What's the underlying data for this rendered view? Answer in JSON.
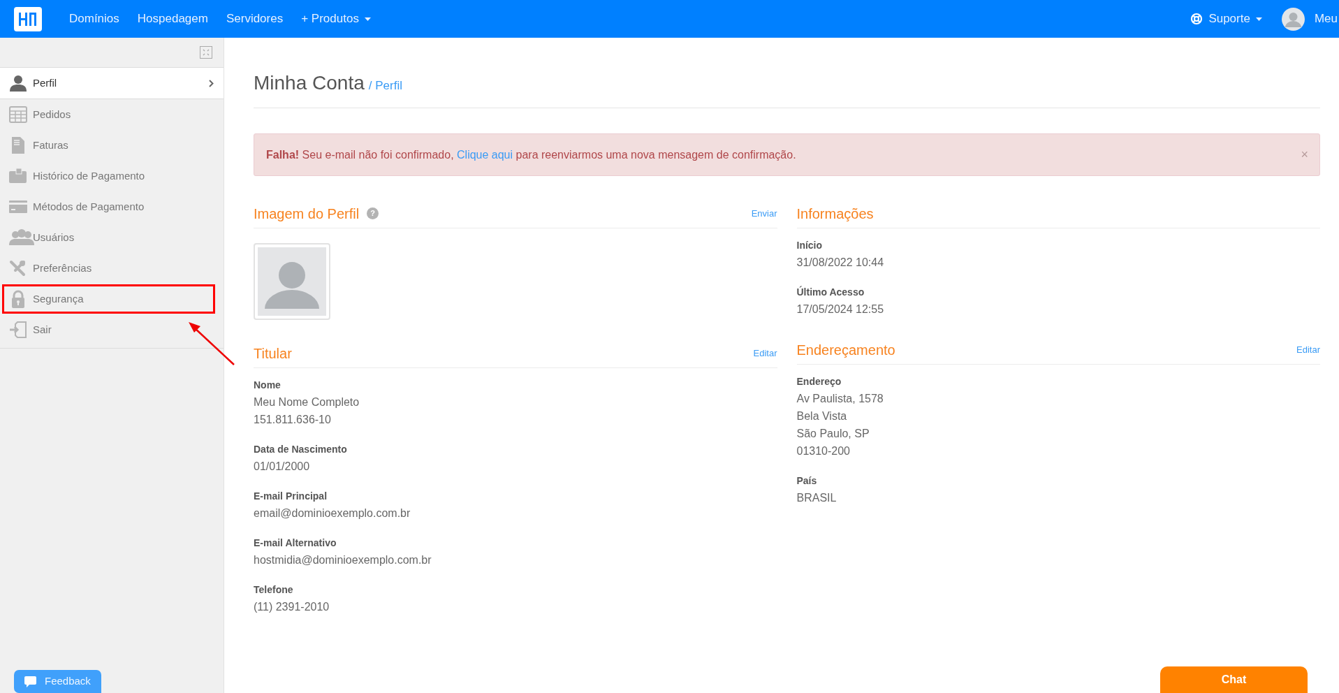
{
  "topnav": {
    "links": [
      {
        "label": "Domínios",
        "dropdown": false
      },
      {
        "label": "Hospedagem",
        "dropdown": false
      },
      {
        "label": "Servidores",
        "dropdown": false
      },
      {
        "label": "+ Produtos",
        "dropdown": true
      }
    ],
    "support": "Suporte",
    "user": "Meu"
  },
  "sidebar": {
    "items": [
      {
        "label": "Perfil",
        "selected": true,
        "annotated": false
      },
      {
        "label": "Pedidos",
        "selected": false,
        "annotated": false
      },
      {
        "label": "Faturas",
        "selected": false,
        "annotated": false
      },
      {
        "label": "Histórico de Pagamento",
        "selected": false,
        "annotated": false
      },
      {
        "label": "Métodos de Pagamento",
        "selected": false,
        "annotated": false
      },
      {
        "label": "Usuários",
        "selected": false,
        "annotated": false
      },
      {
        "label": "Preferências",
        "selected": false,
        "annotated": false
      },
      {
        "label": "Segurança",
        "selected": false,
        "annotated": true
      },
      {
        "label": "Sair",
        "selected": false,
        "annotated": false
      }
    ],
    "feedback": "Feedback"
  },
  "page": {
    "title": "Minha Conta",
    "crumb": "/ Perfil"
  },
  "alert": {
    "strong": "Falha!",
    "before": "Seu e-mail não foi confirmado,",
    "link": "Clique aqui",
    "after": "para reenviarmos uma nova mensagem de confirmação.",
    "close": "×"
  },
  "columns": [
    [
      {
        "title": "Imagem do Perfil",
        "help": "?",
        "action": "Enviar",
        "kind": "avatar"
      },
      {
        "title": "Titular",
        "action": "Editar",
        "kind": "fields",
        "fields": [
          {
            "label": "Nome",
            "lines": [
              "Meu Nome Completo",
              "151.811.636-10"
            ]
          },
          {
            "label": "Data de Nascimento",
            "lines": [
              "01/01/2000"
            ]
          },
          {
            "label": "E-mail Principal",
            "lines": [
              "email@dominioexemplo.com.br"
            ]
          },
          {
            "label": "E-mail Alternativo",
            "lines": [
              "hostmidia@dominioexemplo.com.br"
            ]
          },
          {
            "label": "Telefone",
            "lines": [
              "(11) 2391-2010"
            ]
          }
        ]
      }
    ],
    [
      {
        "title": "Informações",
        "kind": "fields",
        "fields": [
          {
            "label": "Início",
            "lines": [
              "31/08/2022 10:44"
            ]
          },
          {
            "label": "Último Acesso",
            "lines": [
              "17/05/2024 12:55"
            ]
          }
        ]
      },
      {
        "title": "Endereçamento",
        "action": "Editar",
        "kind": "fields",
        "fields": [
          {
            "label": "Endereço",
            "lines": [
              "Av Paulista, 1578",
              "Bela Vista",
              "São Paulo, SP",
              "01310-200"
            ]
          },
          {
            "label": "País",
            "lines": [
              "BRASIL"
            ]
          }
        ]
      }
    ]
  ],
  "chat": "Chat"
}
